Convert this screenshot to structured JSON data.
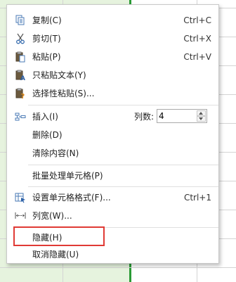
{
  "menu": {
    "items": [
      {
        "label": "复制(C)",
        "shortcut": "Ctrl+C",
        "icon": "copy-icon"
      },
      {
        "label": "剪切(T)",
        "shortcut": "Ctrl+X",
        "icon": "scissors-icon"
      },
      {
        "label": "粘贴(P)",
        "shortcut": "Ctrl+V",
        "icon": "paste-icon"
      },
      {
        "label": "只粘贴文本(Y)",
        "icon": "paste-text-icon"
      },
      {
        "label": "选择性粘贴(S)...",
        "icon": "paste-special-icon"
      },
      {
        "label": "插入(I)",
        "icon": "insert-icon"
      },
      {
        "label": "删除(D)"
      },
      {
        "label": "清除内容(N)"
      },
      {
        "label": "批量处理单元格(P)"
      },
      {
        "label": "设置单元格格式(F)...",
        "shortcut": "Ctrl+1",
        "icon": "format-cells-icon"
      },
      {
        "label": "列宽(W)...",
        "icon": "column-width-icon"
      },
      {
        "label": "隐藏(H)"
      },
      {
        "label": "取消隐藏(U)"
      }
    ],
    "insert_columns_label": "列数:",
    "insert_columns_value": "4"
  },
  "colors": {
    "selection_fill": "#e6f3de",
    "selection_border": "#2a9b35",
    "highlight_box": "#e03a35"
  }
}
